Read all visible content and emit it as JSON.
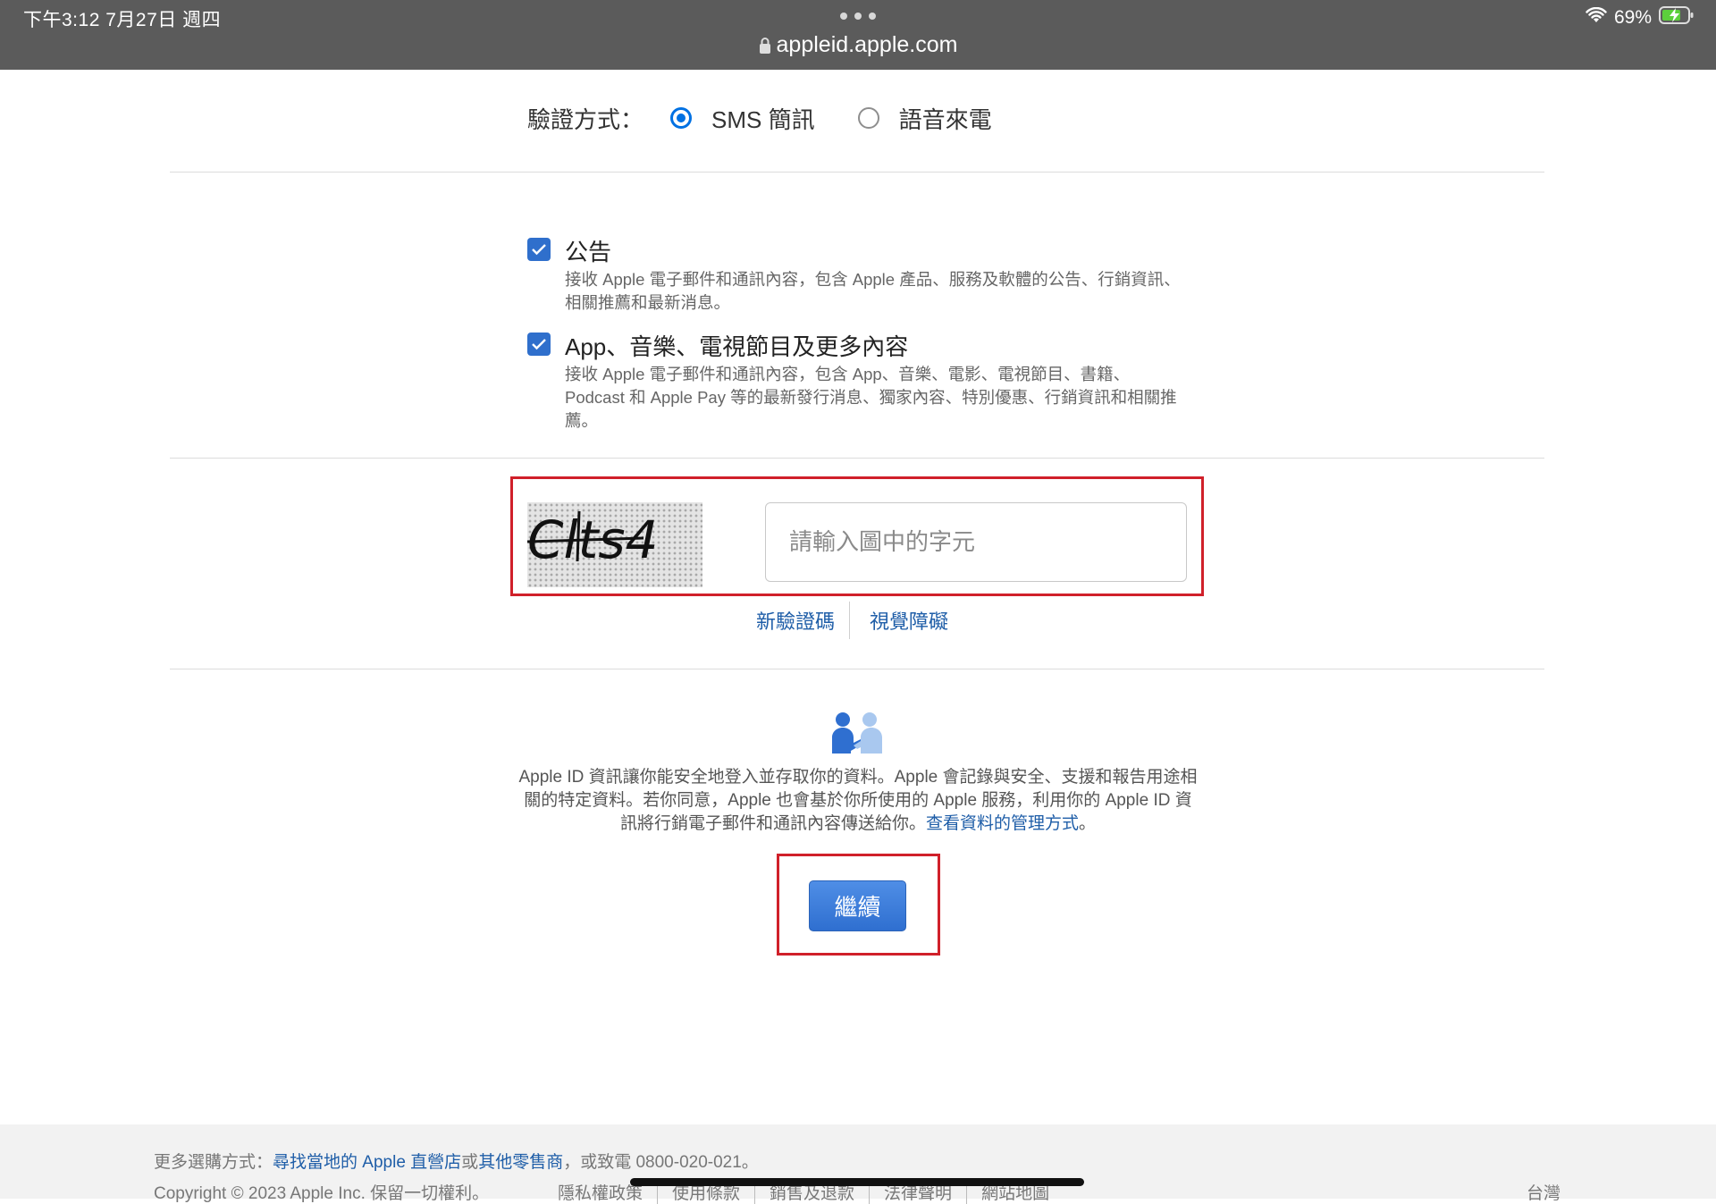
{
  "status_bar": {
    "time_date": "下午3:12   7月27日 週四",
    "battery": "69%"
  },
  "browser": {
    "url": "appleid.apple.com"
  },
  "verify": {
    "label": "驗證方式：",
    "options": [
      "SMS 簡訊",
      "語音來電"
    ],
    "selected": "SMS 簡訊"
  },
  "subscriptions": [
    {
      "title": "公告",
      "description": "接收 Apple 電子郵件和通訊內容，包含 Apple 產品、服務及軟體的公告、行銷資訊、相關推薦和最新消息。",
      "checked": true
    },
    {
      "title": "App、音樂、電視節目及更多內容",
      "description": "接收 Apple 電子郵件和通訊內容，包含 App、音樂、電影、電視節目、書籍、Podcast 和 Apple Pay 等的最新發行消息、獨家內容、特別優惠、行銷資訊和相關推薦。",
      "checked": true
    }
  ],
  "captcha": {
    "image_text": "Clts4",
    "placeholder": "請輸入圖中的字元",
    "value": "",
    "new_code_link": "新驗證碼",
    "accessibility_link": "視覺障礙"
  },
  "privacy": {
    "text": "Apple ID 資訊讓你能安全地登入並存取你的資料。Apple 會記錄與安全、支援和報告用途相關的特定資料。若你同意，Apple 也會基於你所使用的 Apple 服務，利用你的 Apple ID 資訊將行銷電子郵件和通訊內容傳送給你。",
    "link": "查看資料的管理方式",
    "suffix": "。"
  },
  "continue_label": "繼續",
  "footer": {
    "more_prefix": "更多選購方式：",
    "store_link": "尋找當地的 Apple 直營店",
    "or": "或",
    "retailer_link": "其他零售商",
    "phone": "，或致電 0800-020-021。",
    "copyright": "Copyright © 2023 Apple Inc. 保留一切權利。",
    "links": [
      "隱私權政策",
      "使用條款",
      "銷售及退款",
      "法律聲明",
      "網站地圖"
    ],
    "region": "台灣"
  },
  "colors": {
    "accent": "#0071e3",
    "link": "#1f5ea8",
    "highlight": "#d0202a"
  }
}
